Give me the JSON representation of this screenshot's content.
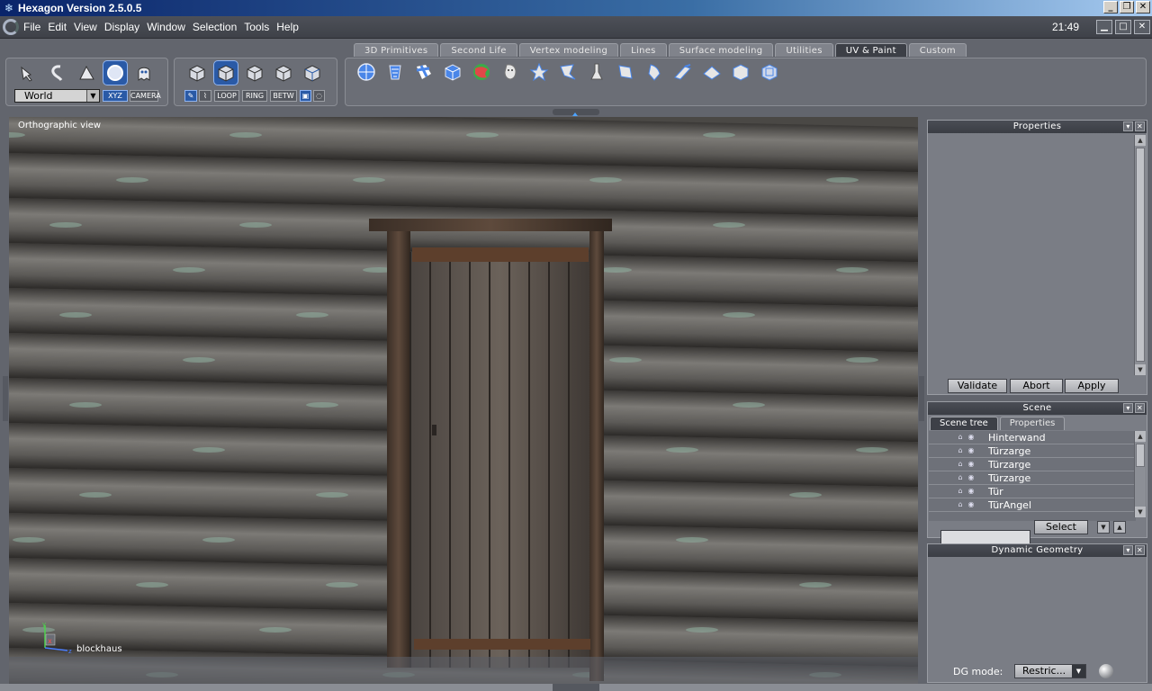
{
  "window": {
    "title": "Hexagon Version 2.5.0.5",
    "controls": [
      "_",
      "❐",
      "✕"
    ]
  },
  "menubar": {
    "items": [
      "File",
      "Edit",
      "View",
      "Display",
      "Window",
      "Selection",
      "Tools",
      "Help"
    ],
    "clock": "21:49",
    "controls": [
      "▁",
      "□",
      "✕"
    ]
  },
  "toolbar": {
    "tabs": [
      "3D Primitives",
      "Second Life",
      "Vertex modeling",
      "Lines",
      "Surface modeling",
      "Utilities",
      "UV & Paint",
      "Custom"
    ],
    "active_tab": "UV & Paint",
    "coord_space": "World",
    "axis_buttons": [
      "XYZ",
      "CAMERA"
    ],
    "selection_buttons": [
      "LOOP",
      "RING",
      "BETW"
    ],
    "left_tool_icons": [
      "select-icon",
      "lasso-icon",
      "fence-icon",
      "sphere-select-icon",
      "ghost-icon"
    ],
    "mode_icons": [
      "vertex-cube-icon",
      "edge-cube-icon",
      "face-cube-icon",
      "object-cube-icon",
      "auto-cube-icon"
    ],
    "uv_icons": [
      "planar-map-icon",
      "cylinder-map-icon",
      "checker-map-icon",
      "box-map-icon",
      "sphere-map-icon",
      "head-map-icon",
      "star-map-icon",
      "unfold-icon",
      "pin-icon",
      "flip-icon",
      "relax-icon",
      "paint-icon",
      "brush-icon",
      "stamp-icon",
      "uv-cube-icon"
    ]
  },
  "viewport": {
    "label": "Orthographic view",
    "object_name": "blockhaus",
    "axes": {
      "x": "x",
      "y": "y",
      "z": "z"
    }
  },
  "properties_panel": {
    "title": "Properties",
    "buttons": {
      "validate": "Validate",
      "abort": "Abort",
      "apply": "Apply"
    }
  },
  "scene_panel": {
    "title": "Scene",
    "tabs": [
      "Scene tree",
      "Properties"
    ],
    "items": [
      {
        "name": "Hinterwand"
      },
      {
        "name": "Türzarge"
      },
      {
        "name": "Türzarge"
      },
      {
        "name": "Türzarge"
      },
      {
        "name": "Tür"
      },
      {
        "name": "TürAngel"
      }
    ],
    "search_value": "",
    "select_label": "Select"
  },
  "dynamic_geometry_panel": {
    "title": "Dynamic Geometry",
    "mode_label": "DG mode:",
    "mode_value": "Restric..."
  },
  "colors": {
    "accent": "#2a5aa6",
    "title_gradient_start": "#0a246a",
    "panel_bg": "#7a7d85"
  }
}
